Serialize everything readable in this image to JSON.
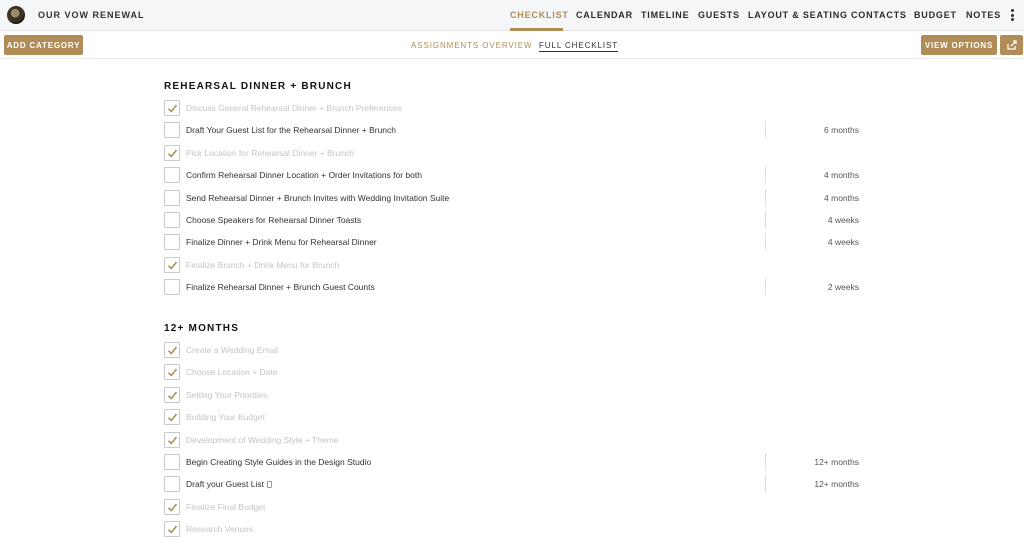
{
  "header": {
    "title": "OUR VOW RENEWAL",
    "nav": [
      "CHECKLIST",
      "CALENDAR",
      "TIMELINE",
      "GUESTS",
      "LAYOUT & SEATING",
      "CONTACTS",
      "BUDGET",
      "NOTES"
    ],
    "active_nav": "CHECKLIST"
  },
  "toolbar": {
    "add_category": "ADD CATEGORY",
    "tab_assignments": "ASSIGNMENTS OVERVIEW",
    "tab_full": "FULL CHECKLIST",
    "view_options": "VIEW OPTIONS"
  },
  "colors": {
    "accent": "#b08d57"
  },
  "sections": [
    {
      "title": "REHEARSAL DINNER + BRUNCH",
      "tasks": [
        {
          "label": "Discuss General Rehearsal Dinner + Brunch Preferences",
          "done": true,
          "due": ""
        },
        {
          "label": "Draft Your Guest List for the Rehearsal Dinner + Brunch",
          "done": false,
          "due": "6 months"
        },
        {
          "label": "Pick Location for Rehearsal Dinner + Brunch",
          "done": true,
          "due": ""
        },
        {
          "label": "Confirm Rehearsal Dinner Location + Order Invitations for both",
          "done": false,
          "due": "4 months"
        },
        {
          "label": "Send Rehearsal Dinner + Brunch Invites with Wedding Invitation Suite",
          "done": false,
          "due": "4 months"
        },
        {
          "label": "Choose Speakers for Rehearsal Dinner Toasts",
          "done": false,
          "due": "4 weeks"
        },
        {
          "label": "Finalize Dinner + Drink Menu for Rehearsal Dinner",
          "done": false,
          "due": "4 weeks"
        },
        {
          "label": "Finalize Brunch + Drink Menu for Brunch",
          "done": true,
          "due": ""
        },
        {
          "label": "Finalize Rehearsal Dinner + Brunch Guest Counts",
          "done": false,
          "due": "2 weeks"
        }
      ]
    },
    {
      "title": "12+ MONTHS",
      "tasks": [
        {
          "label": "Create a Wedding Email",
          "done": true,
          "due": ""
        },
        {
          "label": "Choose Location + Date",
          "done": true,
          "due": ""
        },
        {
          "label": "Setting Your Priorities",
          "done": true,
          "due": ""
        },
        {
          "label": "Building Your Budget",
          "done": true,
          "due": ""
        },
        {
          "label": "Development of Wedding Style + Theme",
          "done": true,
          "due": ""
        },
        {
          "label": "Begin Creating Style Guides in the Design Studio",
          "done": false,
          "due": "12+ months"
        },
        {
          "label": "Draft your Guest List",
          "done": false,
          "due": "12+ months",
          "doc_icon": true
        },
        {
          "label": "Finalize Final Budget",
          "done": true,
          "due": ""
        },
        {
          "label": "Research Venues",
          "done": true,
          "due": ""
        }
      ]
    }
  ]
}
